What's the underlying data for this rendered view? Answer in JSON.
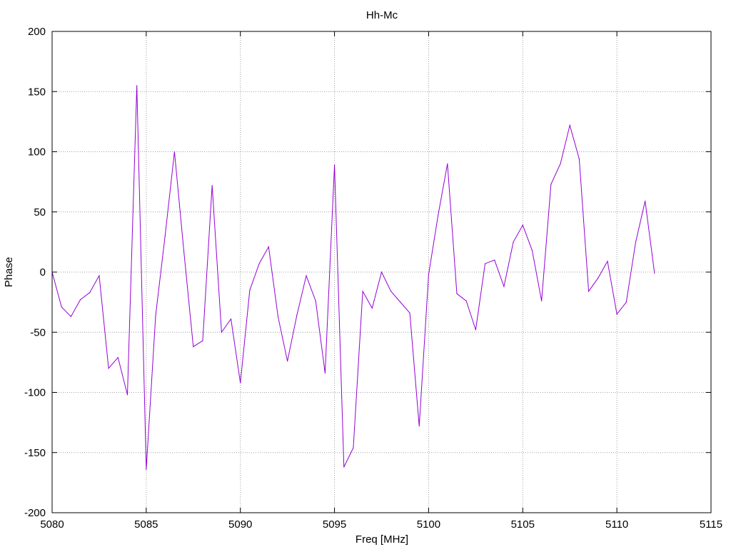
{
  "chart_data": {
    "type": "line",
    "title": "Hh-Mc",
    "xlabel": "Freq [MHz]",
    "ylabel": "Phase",
    "xlim": [
      5080,
      5115
    ],
    "ylim": [
      -200,
      200
    ],
    "xticks": [
      5080,
      5085,
      5090,
      5095,
      5100,
      5105,
      5110,
      5115
    ],
    "yticks": [
      -200,
      -150,
      -100,
      -50,
      0,
      50,
      100,
      150,
      200
    ],
    "grid": true,
    "line_color": "#9400d3",
    "series": [
      {
        "x": [
          5080,
          5080.5,
          5081,
          5081.5,
          5082,
          5082.5,
          5083,
          5083.5,
          5084,
          5084.5,
          5085,
          5085.5,
          5086,
          5086.5,
          5087,
          5087.5,
          5088,
          5088.5,
          5089,
          5089.5,
          5090,
          5090.5,
          5091,
          5091.5,
          5092,
          5092.5,
          5093,
          5093.5,
          5094,
          5094.5,
          5095,
          5095.5,
          5096,
          5096.5,
          5097,
          5097.5,
          5098,
          5098.5,
          5099,
          5099.5,
          5100,
          5100.5,
          5101,
          5101.5,
          5102,
          5102.5,
          5103,
          5103.5,
          5104,
          5104.5,
          5105,
          5105.5,
          5106,
          5106.5,
          5107,
          5107.5,
          5108,
          5108.5,
          5109,
          5109.5,
          5110,
          5110.5,
          5111,
          5111.5,
          5112
        ],
        "values": [
          0,
          -29,
          -37,
          -23,
          -17,
          -3,
          -80,
          -71,
          -102,
          155,
          -164,
          -36,
          30,
          100,
          17,
          -62,
          -57,
          72,
          -50,
          -39,
          -92,
          -15,
          7,
          21,
          -37,
          -74,
          -36,
          -3,
          -24,
          -84,
          89,
          -162,
          -146,
          -16,
          -30,
          0,
          -16,
          -25,
          -34,
          -128,
          -2,
          47,
          90,
          -18,
          -24,
          -48,
          7,
          10,
          -12,
          25,
          39,
          18,
          -24,
          73,
          90,
          122,
          94,
          -16,
          -5,
          9,
          -35,
          -25,
          25,
          59,
          -1
        ]
      }
    ]
  }
}
